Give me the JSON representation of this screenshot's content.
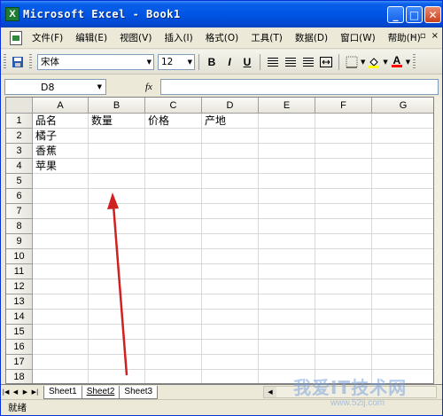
{
  "window": {
    "title": "Microsoft Excel - Book1",
    "app_icon_letter": "X"
  },
  "menu": {
    "items": [
      "文件(F)",
      "编辑(E)",
      "视图(V)",
      "插入(I)",
      "格式(O)",
      "工具(T)",
      "数据(D)",
      "窗口(W)",
      "帮助(H)"
    ],
    "doc_controls": [
      "-",
      "▫",
      "×"
    ]
  },
  "toolbar": {
    "font_name": "宋体",
    "font_size": "12",
    "bold_label": "B",
    "italic_label": "I",
    "underline_label": "U",
    "fill_label": "A"
  },
  "formula_bar": {
    "cell_ref": "D8",
    "fx_label": "fx"
  },
  "sheet": {
    "columns": [
      "A",
      "B",
      "C",
      "D",
      "E",
      "F",
      "G"
    ],
    "rows": [
      "1",
      "2",
      "3",
      "4",
      "5",
      "6",
      "7",
      "8",
      "9",
      "10",
      "11",
      "12",
      "13",
      "14",
      "15",
      "16",
      "17",
      "18"
    ],
    "cells": {
      "A1": "品名",
      "B1": "数量",
      "C1": "价格",
      "D1": "产地",
      "A2": "橘子",
      "A3": "香蕉",
      "A4": "苹果"
    }
  },
  "tabs": [
    "Sheet1",
    "Sheet2",
    "Sheet3"
  ],
  "active_tab": "Sheet2",
  "status": "就绪",
  "watermark": {
    "text": "我爱IT技术网",
    "url": "www.52ij.com"
  },
  "colors": {
    "title_bar": "#0055E5",
    "arrow": "#D02020"
  }
}
